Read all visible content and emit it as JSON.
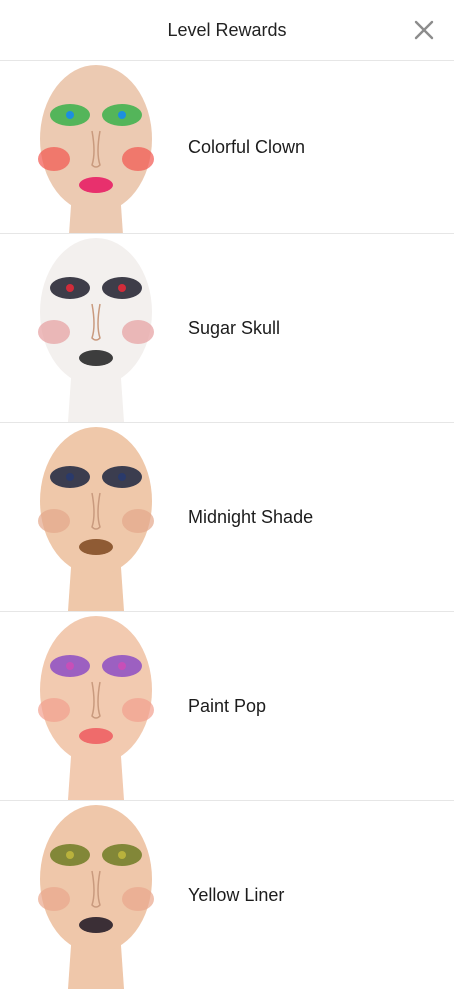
{
  "header": {
    "title": "Level Rewards",
    "close_icon": "close-icon"
  },
  "rewards": [
    {
      "label": "Colorful Clown",
      "theme": {
        "skin": "#eccab2",
        "eyes": "#39b24a",
        "lips": "#e8306d",
        "cheeks": "#f2564e",
        "accent": "#1c8fe0"
      }
    },
    {
      "label": "Sugar Skull",
      "theme": {
        "skin": "#f3f0ee",
        "eyes": "#1d1d2b",
        "lips": "#3d3d3d",
        "cheeks": "#e69ea0",
        "accent": "#d22c3a"
      }
    },
    {
      "label": "Midnight Shade",
      "theme": {
        "skin": "#efc8aa",
        "eyes": "#1b2440",
        "lips": "#8f5b34",
        "cheeks": "#e4a78a",
        "accent": "#2a3a6b"
      }
    },
    {
      "label": "Paint Pop",
      "theme": {
        "skin": "#f2cab0",
        "eyes": "#8d4ec4",
        "lips": "#ef6b6b",
        "cheeks": "#f2a08e",
        "accent": "#c74fb8"
      }
    },
    {
      "label": "Yellow Liner",
      "theme": {
        "skin": "#efc7aa",
        "eyes": "#6f7b25",
        "lips": "#3b2f36",
        "cheeks": "#e9a68c",
        "accent": "#b9b23c"
      }
    }
  ]
}
